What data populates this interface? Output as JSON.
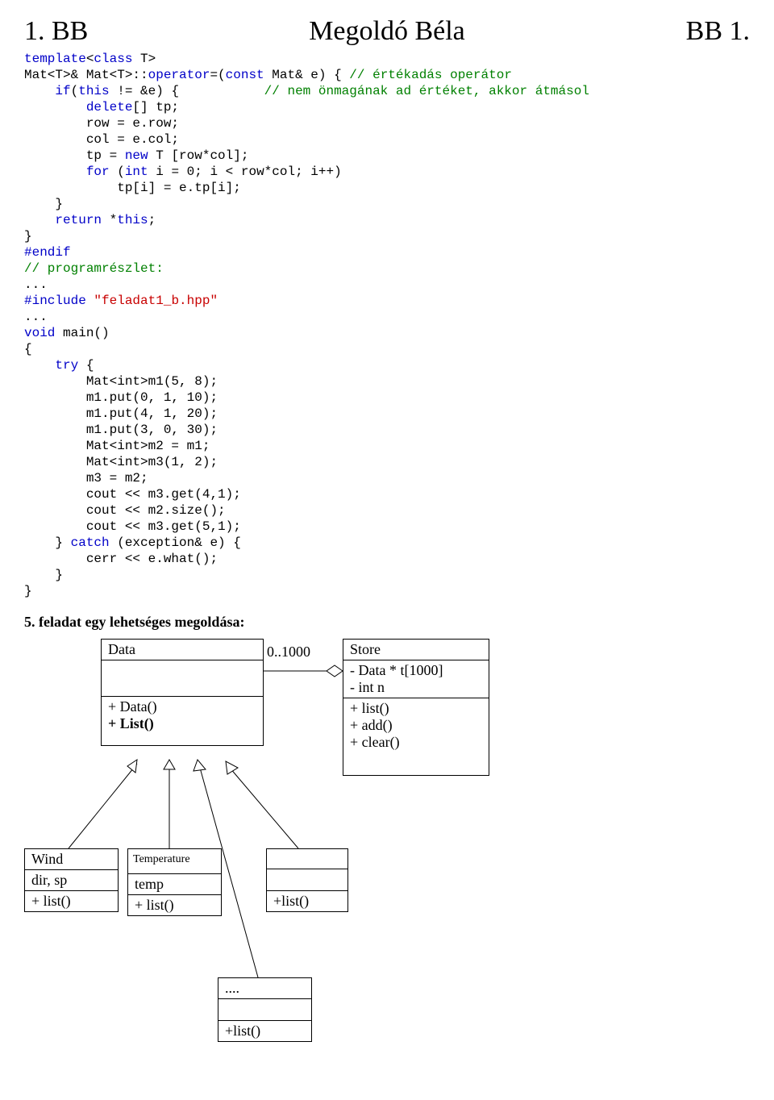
{
  "header": {
    "left": "1. BB",
    "center": "Megoldó Béla",
    "right": "BB 1."
  },
  "code": {
    "l1a": "template",
    "l1b": "<",
    "l1c": "class",
    "l1d": " T>",
    "l2a": "Mat<T>& Mat<T>::",
    "l2b": "operator",
    "l2c": "=(",
    "l2d": "const",
    "l2e": " Mat& e) { ",
    "l2f": "// értékadás operátor",
    "l3a": "    ",
    "l3b": "if",
    "l3c": "(",
    "l3d": "this",
    "l3e": " != &e) {           ",
    "l3f": "// nem önmagának ad értéket, akkor átmásol",
    "l4a": "        ",
    "l4b": "delete",
    "l4c": "[] tp;",
    "l5": "        row = e.row;",
    "l6": "        col = e.col;",
    "l7a": "        tp = ",
    "l7b": "new",
    "l7c": " T [row*col];",
    "l8a": "        ",
    "l8b": "for",
    "l8c": " (",
    "l8d": "int",
    "l8e": " i = 0; i < row*col; i++)",
    "l9": "            tp[i] = e.tp[i];",
    "l10": "    }",
    "l11a": "    ",
    "l11b": "return",
    "l11c": " *",
    "l11d": "this",
    "l11e": ";",
    "l12": "}",
    "l13": "#endif",
    "l14": "// programrészlet:",
    "l15": "...",
    "l16a": "#include ",
    "l16b": "\"feladat1_b.hpp\"",
    "l17": "...",
    "l18a": "void",
    "l18b": " main()",
    "l19": "{",
    "l20a": "    ",
    "l20b": "try",
    "l20c": " {",
    "l21": "        Mat<int>m1(5, 8);",
    "l22": "        m1.put(0, 1, 10);",
    "l23": "        m1.put(4, 1, 20);",
    "l24": "        m1.put(3, 0, 30);",
    "l25": "        Mat<int>m2 = m1;",
    "l26": "        Mat<int>m3(1, 2);",
    "l27": "        m3 = m2;",
    "l28": "        cout << m3.get(4,1);",
    "l29": "        cout << m2.size();",
    "l30": "        cout << m3.get(5,1);",
    "l31a": "    } ",
    "l31b": "catch",
    "l31c": " (exception& e) {",
    "l32": "        cerr << e.what();",
    "l33": "    }",
    "l34": "}"
  },
  "section": "5. feladat egy lehetséges megoldása:",
  "uml": {
    "data": {
      "title": "Data",
      "ops1": "+ Data()",
      "ops2": "+ List()"
    },
    "store": {
      "title": "Store",
      "attr1": "- Data * t[1000]",
      "attr2": "- int n",
      "op1": "+ list()",
      "op2": "+ add()",
      "op3": "+ clear()"
    },
    "wind": {
      "title": "Wind",
      "attr": "dir, sp",
      "op": "+ list()"
    },
    "temp": {
      "title": "Temperature",
      "attr": "temp",
      "op": "+ list()"
    },
    "anon1": {
      "op": "+list()"
    },
    "anon2": {
      "title": "....",
      "op": "+list()"
    },
    "assoc": "0..1000"
  }
}
